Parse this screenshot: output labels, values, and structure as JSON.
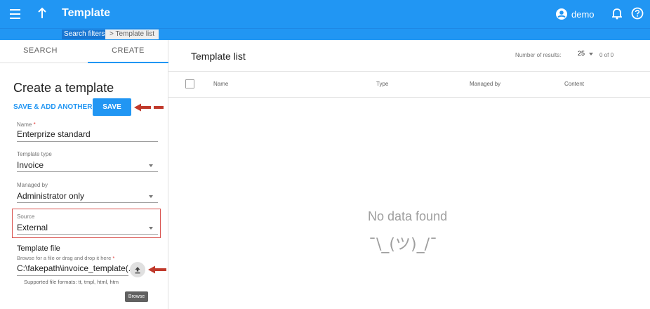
{
  "appbar": {
    "title": "Template",
    "user": "demo",
    "icons": [
      "menu-icon",
      "arrow-up-icon",
      "account-icon",
      "bell-icon",
      "help-icon"
    ],
    "color": "#2196f3"
  },
  "breadcrumb": {
    "filters": "Search filters",
    "current": "> Template list"
  },
  "tabs": {
    "search": "SEARCH",
    "create": "CREATE"
  },
  "create_form": {
    "title": "Create a template",
    "save_add_label": "SAVE & ADD ANOTHER",
    "save_label": "SAVE",
    "name": {
      "label": "Name",
      "required_mark": "*",
      "value": "Enterprize standard"
    },
    "template_type": {
      "label": "Template type",
      "value": "Invoice"
    },
    "managed_by": {
      "label": "Managed by",
      "value": "Administrator only"
    },
    "source": {
      "label": "Source",
      "value": "External"
    },
    "template_file": {
      "title": "Template file",
      "hint": "Browse for a file or drag and drop it here",
      "required_mark": "*",
      "value": "C:\\fakepath\\invoice_template(...",
      "formats": "Supported file formats: tt, tmpl, html, htm",
      "browse_label": "Browse"
    },
    "highlight_color": "#d9534f",
    "annotation_arrow_color": "#c0392b"
  },
  "main": {
    "title": "Template list",
    "results_label": "Number of results:",
    "results_per_page": "25",
    "results_count": "0 of 0",
    "columns": [
      "Name",
      "Type",
      "Managed by",
      "Content"
    ],
    "empty_text": "No data found",
    "empty_emoticon": "¯\\_(ツ)_/¯"
  }
}
